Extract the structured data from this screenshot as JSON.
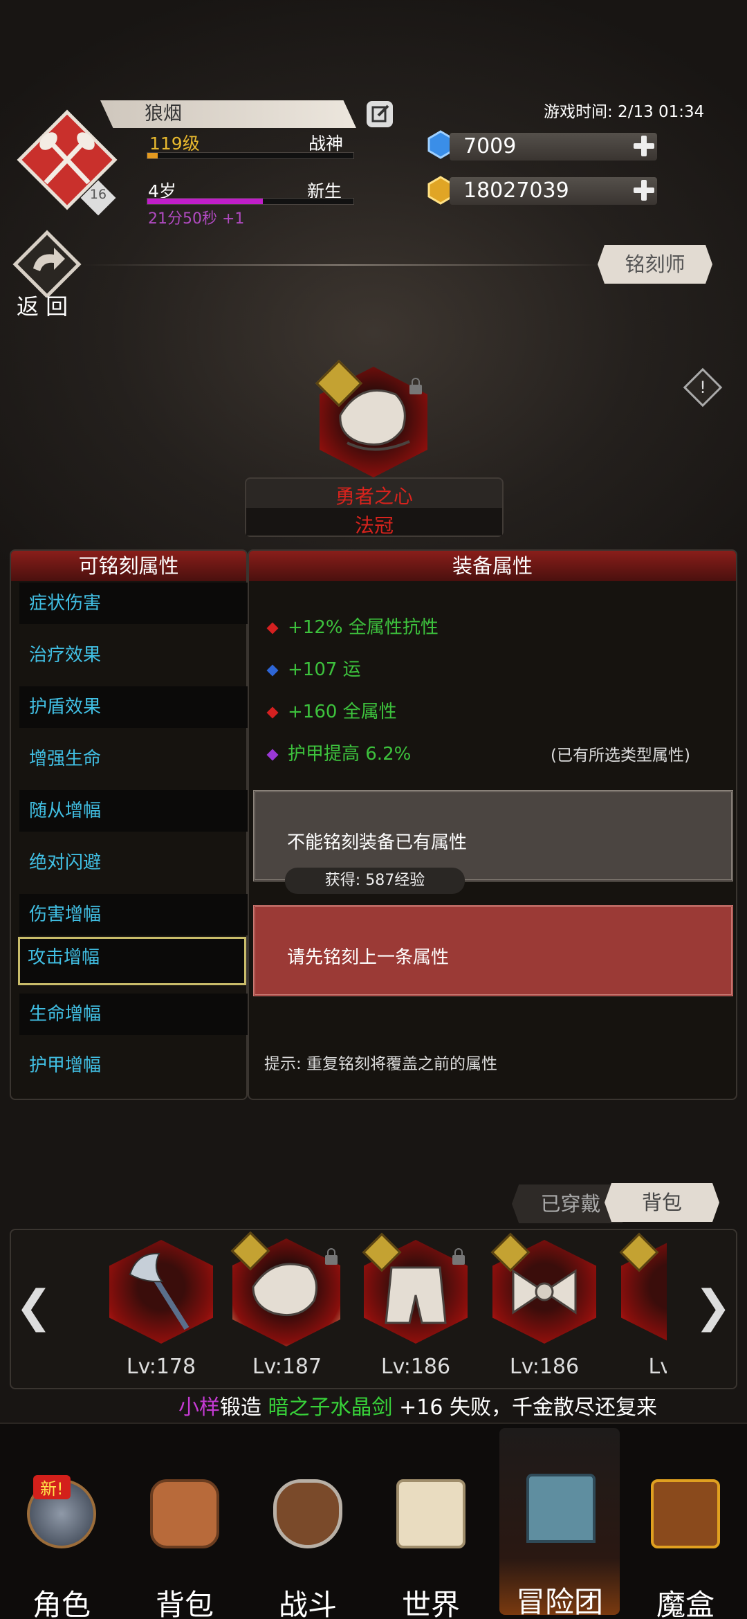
{
  "player": {
    "name": "狼烟",
    "level_text": "119级",
    "title": "战神",
    "age_text": "4岁",
    "stage": "新生",
    "timer_text": "21分50秒 +1",
    "rank": "16"
  },
  "game_time": "游戏时间: 2/13 01:34",
  "currency": {
    "gems": "7009",
    "gold": "18027039"
  },
  "back_label": "返 回",
  "npc_label": "铭刻师",
  "item": {
    "name": "勇者之心",
    "type": "法冠"
  },
  "left_panel": {
    "title": "可铭刻属性",
    "items": [
      "症状伤害",
      "治疗效果",
      "护盾效果",
      "增强生命",
      "随从增幅",
      "绝对闪避",
      "伤害增幅",
      "攻击增幅",
      "生命增幅",
      "护甲增幅"
    ]
  },
  "right_panel": {
    "title": "装备属性",
    "attrs": [
      "+12% 全属性抗性",
      "+107 运",
      "+160 全属性",
      "护甲提高 6.2%"
    ],
    "attr_note": "(已有所选类型属性)",
    "box1_text": "不能铭刻装备已有属性",
    "exp_text": "获得: 587经验",
    "box2_text": "请先铭刻上一条属性",
    "hint": "提示:  重复铭刻将覆盖之前的属性"
  },
  "tabs": {
    "worn": "已穿戴",
    "bag": "背包"
  },
  "equip_list": [
    "Lv:178",
    "Lv:187",
    "Lv:186",
    "Lv:186",
    "Lv:"
  ],
  "ticker": {
    "user": "小样",
    "verb": "锻造",
    "item": "暗之子水晶剑",
    "rest": "+16 失败，千金散尽还复来"
  },
  "nav": {
    "new_badge": "新!",
    "items": [
      "角色",
      "背包",
      "战斗",
      "世界",
      "冒险团",
      "魔盒"
    ]
  },
  "colors": {
    "accent_red": "#8a1e1a",
    "cyan": "#41bfe3",
    "green": "#3dc23d",
    "red_text": "#d8231d"
  }
}
